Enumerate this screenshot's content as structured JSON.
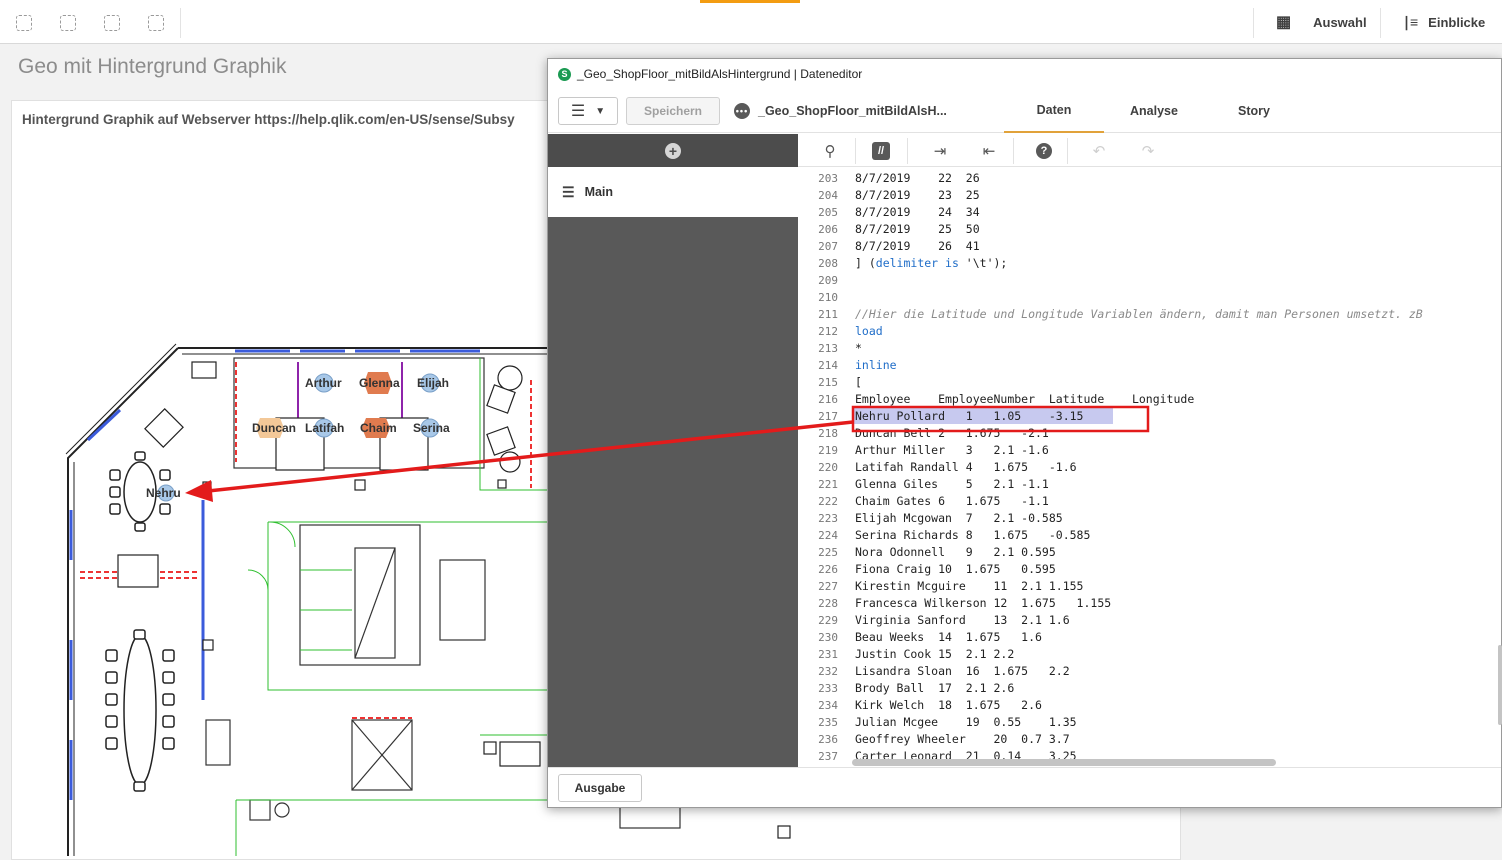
{
  "toolbar": {
    "selection_label": "Auswahl",
    "insights_label": "Einblicke"
  },
  "sheet": {
    "title": "Geo mit Hintergrund Graphik",
    "panel_header": "Hintergrund Graphik auf Webserver https://help.qlik.com/en-US/sense/Subsy",
    "employees_on_map": [
      "Arthur",
      "Glenna",
      "Elijah",
      "Duncan",
      "Latifah",
      "Chaim",
      "Serina",
      "Nehru"
    ]
  },
  "editor": {
    "window_title": "_Geo_ShopFloor_mitBildAlsHintergrund | Dateneditor",
    "save_label": "Speichern",
    "app_name": "_Geo_ShopFloor_mitBildAlsH...",
    "tabs": [
      "Daten",
      "Analyse",
      "Story"
    ],
    "active_tab": "Daten",
    "section_main": "Main",
    "output_label": "Ausgabe",
    "code_lines": [
      {
        "n": "203",
        "t": "8/7/2019    22  26",
        "k": ""
      },
      {
        "n": "204",
        "t": "8/7/2019    23  25",
        "k": ""
      },
      {
        "n": "205",
        "t": "8/7/2019    24  34",
        "k": ""
      },
      {
        "n": "206",
        "t": "8/7/2019    25  50",
        "k": ""
      },
      {
        "n": "207",
        "t": "8/7/2019    26  41",
        "k": ""
      },
      {
        "n": "208",
        "t": "] (delimiter is '\\t');",
        "k": "mixed"
      },
      {
        "n": "209",
        "t": "",
        "k": ""
      },
      {
        "n": "210",
        "t": "",
        "k": ""
      },
      {
        "n": "211",
        "t": "//Hier die Latitude und Longitude Variablen ändern, damit man Personen umsetzt. zB",
        "k": "cmt"
      },
      {
        "n": "212",
        "t": "load",
        "k": "kw"
      },
      {
        "n": "213",
        "t": "*",
        "k": ""
      },
      {
        "n": "214",
        "t": "inline",
        "k": "kw"
      },
      {
        "n": "215",
        "t": "[",
        "k": ""
      },
      {
        "n": "216",
        "t": "Employee    EmployeeNumber  Latitude    Longitude",
        "k": ""
      },
      {
        "n": "217",
        "t": "Nehru Pollard   1   1.05    -3.15",
        "k": ""
      },
      {
        "n": "218",
        "t": "Duncan Bell 2   1.675   -2.1",
        "k": ""
      },
      {
        "n": "219",
        "t": "Arthur Miller   3   2.1 -1.6",
        "k": ""
      },
      {
        "n": "220",
        "t": "Latifah Randall 4   1.675   -1.6",
        "k": ""
      },
      {
        "n": "221",
        "t": "Glenna Giles    5   2.1 -1.1",
        "k": ""
      },
      {
        "n": "222",
        "t": "Chaim Gates 6   1.675   -1.1",
        "k": ""
      },
      {
        "n": "223",
        "t": "Elijah Mcgowan  7   2.1 -0.585",
        "k": ""
      },
      {
        "n": "224",
        "t": "Serina Richards 8   1.675   -0.585",
        "k": ""
      },
      {
        "n": "225",
        "t": "Nora Odonnell   9   2.1 0.595",
        "k": ""
      },
      {
        "n": "226",
        "t": "Fiona Craig 10  1.675   0.595",
        "k": ""
      },
      {
        "n": "227",
        "t": "Kirestin Mcguire    11  2.1 1.155",
        "k": ""
      },
      {
        "n": "228",
        "t": "Francesca Wilkerson 12  1.675   1.155",
        "k": ""
      },
      {
        "n": "229",
        "t": "Virginia Sanford    13  2.1 1.6",
        "k": ""
      },
      {
        "n": "230",
        "t": "Beau Weeks  14  1.675   1.6",
        "k": ""
      },
      {
        "n": "231",
        "t": "Justin Cook 15  2.1 2.2",
        "k": ""
      },
      {
        "n": "232",
        "t": "Lisandra Sloan  16  1.675   2.2",
        "k": ""
      },
      {
        "n": "233",
        "t": "Brody Ball  17  2.1 2.6",
        "k": ""
      },
      {
        "n": "234",
        "t": "Kirk Welch  18  1.675   2.6",
        "k": ""
      },
      {
        "n": "235",
        "t": "Julian Mcgee    19  0.55    1.35",
        "k": ""
      },
      {
        "n": "236",
        "t": "Geoffrey Wheeler    20  0.7 3.7",
        "k": ""
      },
      {
        "n": "237",
        "t": "Carter Leonard  21  0.14    3.25",
        "k": ""
      }
    ]
  },
  "colors": {
    "accent": "#e1a23a",
    "highlight_box": "#e31b1b",
    "selection": "#c7c9ef",
    "sidebar": "#595959"
  }
}
